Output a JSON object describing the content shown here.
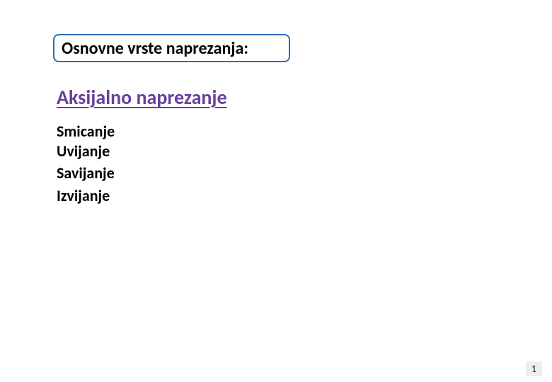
{
  "title": "Osnovne vrste naprezanja:",
  "heading": "Aksijalno naprezanje",
  "items": [
    "Smicanje",
    "Uvijanje",
    "Savijanje",
    "Izvijanje"
  ],
  "page_number": "1"
}
